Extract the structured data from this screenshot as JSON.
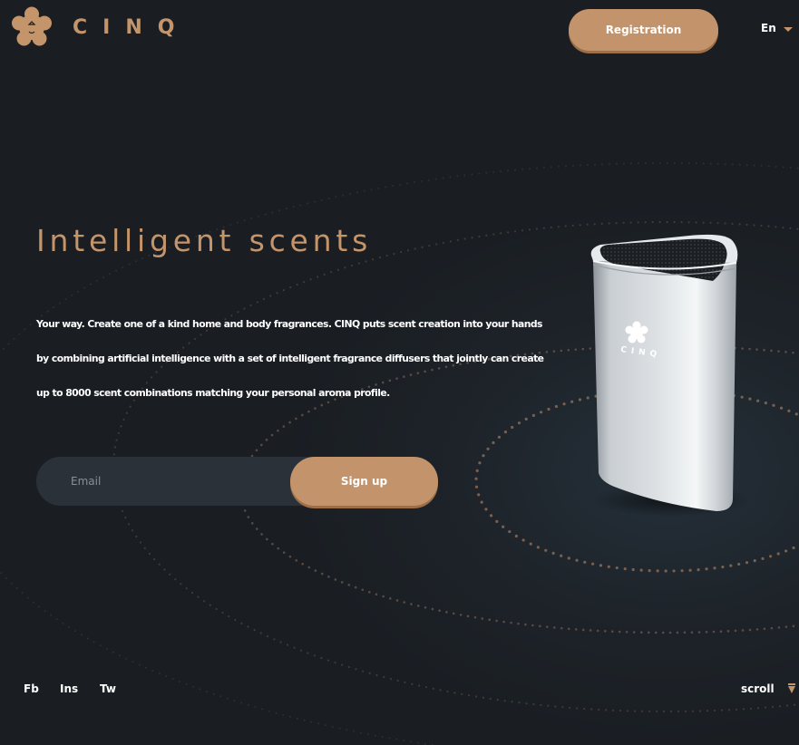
{
  "brand": {
    "name": "CINQ",
    "accent_color": "#c4946a",
    "logo_icon": "flower-logo-icon"
  },
  "header": {
    "registration_label": "Registration",
    "language": "En",
    "language_icon": "caret-down-icon"
  },
  "hero": {
    "headline": "Intelligent scents",
    "description": "Your way. Create one of a kind home and body fragrances. CINQ puts scent creation into your hands by combining artificial intelligence with a set of intelligent fragrance diffusers that jointly can create up to 8000 scent combinations matching your personal aroma profile.",
    "email_placeholder": "Email",
    "signup_label": "Sign up",
    "device_label": "CINQ",
    "device_image": "cinq-diffuser-device"
  },
  "footer": {
    "social": [
      "Fb",
      "Ins",
      "Tw"
    ],
    "scroll_label": "scroll",
    "scroll_icon": "scroll-down-icon"
  },
  "colors": {
    "background": "#1a1e23",
    "button": "#c3946b",
    "input_bg": "#2a3139"
  }
}
